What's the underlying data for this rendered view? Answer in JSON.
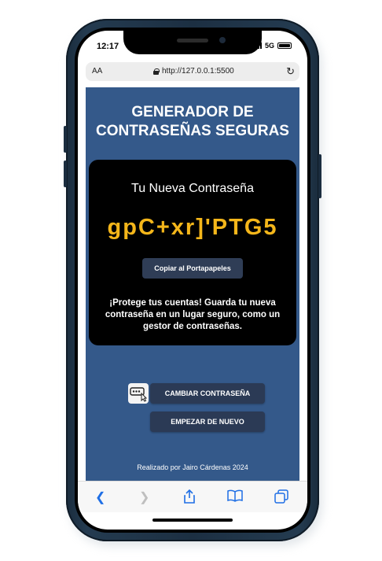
{
  "status_bar": {
    "time": "12:17",
    "network": "5G"
  },
  "browser": {
    "text_size_label": "AA",
    "url": "http://127.0.0.1:5500"
  },
  "page": {
    "title_line1": "GENERADOR DE",
    "title_line2": "CONTRASEÑAS SEGURAS",
    "card_heading": "Tu Nueva Contraseña",
    "password": "gpC+xr]'PTG5",
    "copy_button": "Copiar al Portapapeles",
    "tip_text": "¡Protege tus cuentas! Guarda tu nueva contraseña en un lugar seguro, como un gestor de contraseñas.",
    "change_button": "CAMBIAR CONTRASEÑA",
    "restart_button": "EMPEZAR DE NUEVO",
    "footer": "Realizado por Jairo Cárdenas 2024"
  },
  "colors": {
    "page_background": "#34598a",
    "card_background": "#000000",
    "password_color": "#f4b61a",
    "button_background": "#2b3a55",
    "toolbar_accent": "#1f6fe5"
  },
  "icons": [
    "lock-icon",
    "reload-icon",
    "change-password-icon",
    "back-icon",
    "forward-icon",
    "share-icon",
    "bookmarks-icon",
    "tabs-icon"
  ]
}
